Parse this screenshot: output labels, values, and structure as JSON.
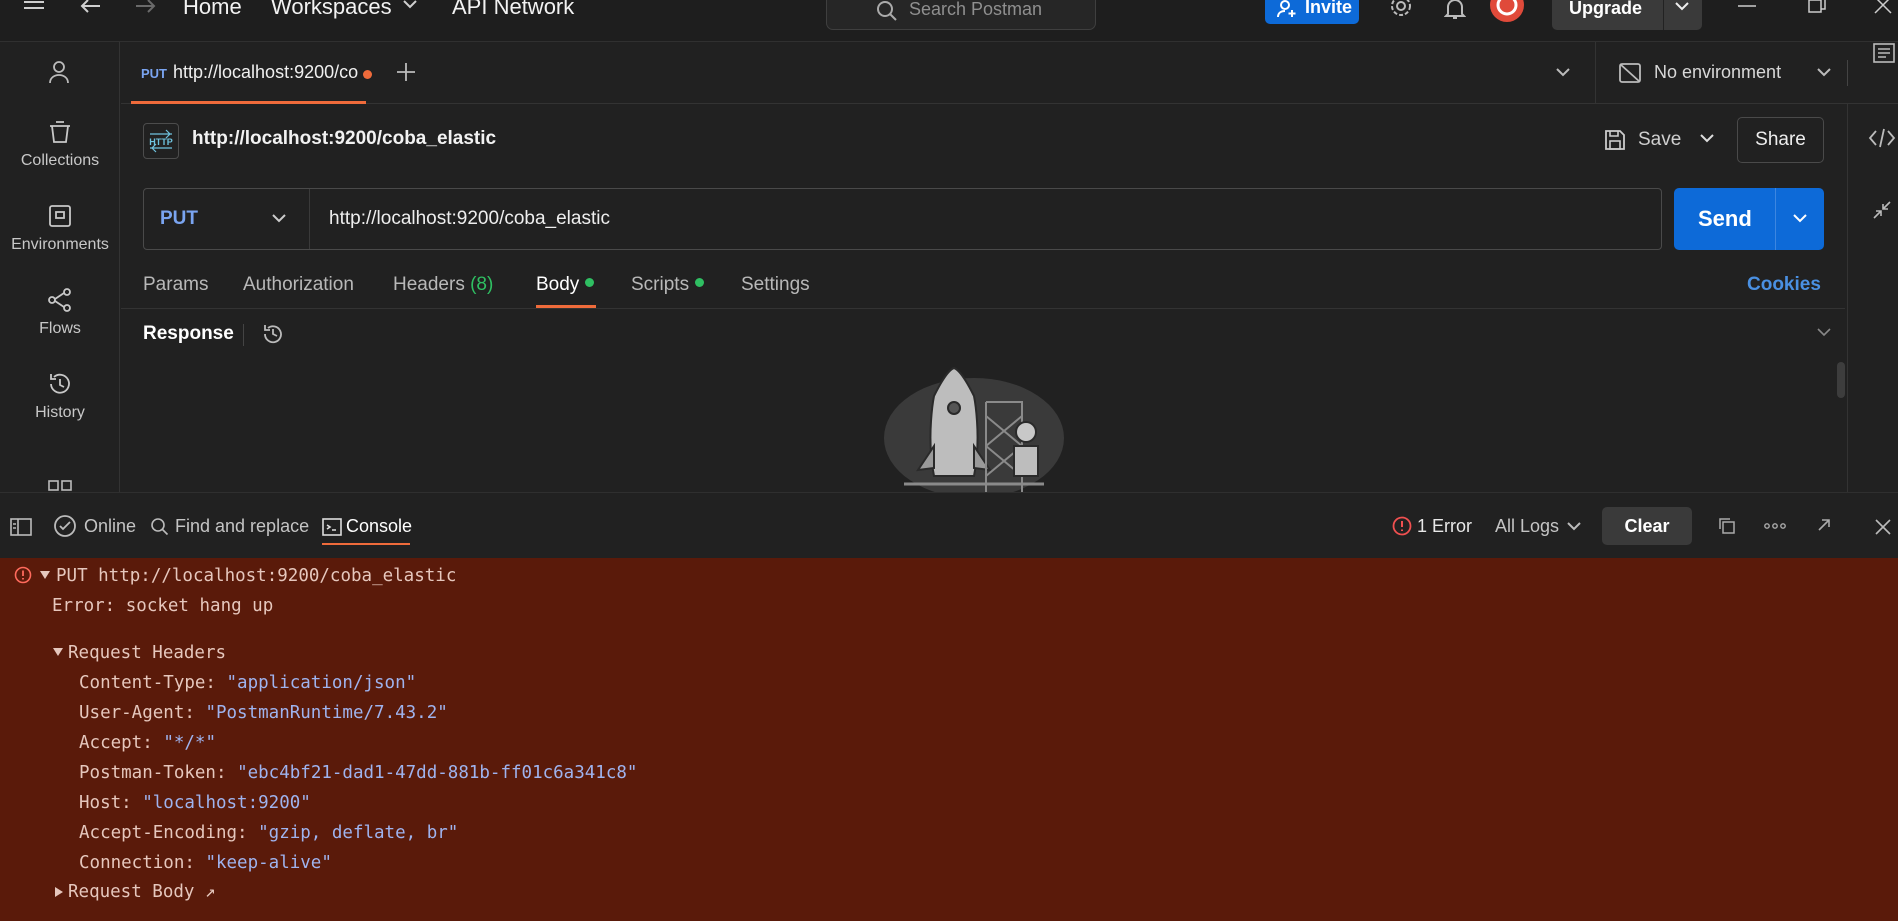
{
  "titlebar": {
    "home": "Home",
    "workspaces": "Workspaces",
    "api_network": "API Network",
    "search_placeholder": "Search Postman",
    "invite": "Invite",
    "upgrade": "Upgrade"
  },
  "sidebar": {
    "items": [
      {
        "label": "Collections",
        "icon": "collections-icon"
      },
      {
        "label": "Environments",
        "icon": "environments-icon"
      },
      {
        "label": "Flows",
        "icon": "flows-icon"
      },
      {
        "label": "History",
        "icon": "history-icon"
      }
    ]
  },
  "tab": {
    "method": "PUT",
    "url": "http://localhost:9200/coba_elastic"
  },
  "environment": "No environment",
  "request": {
    "title": "http://localhost:9200/coba_elastic",
    "save": "Save",
    "share": "Share",
    "method": "PUT",
    "url": "http://localhost:9200/coba_elastic",
    "send": "Send"
  },
  "request_tabs": {
    "params": "Params",
    "authorization": "Authorization",
    "headers": "Headers",
    "headers_count": "(8)",
    "body": "Body",
    "scripts": "Scripts",
    "settings": "Settings",
    "cookies": "Cookies"
  },
  "response": {
    "title": "Response"
  },
  "statusbar": {
    "online": "Online",
    "find_replace": "Find and replace",
    "console": "Console",
    "errors": "1 Error",
    "logs_filter": "All Logs",
    "clear": "Clear"
  },
  "console": {
    "request_line": "PUT http://localhost:9200/coba_elastic",
    "error": "Error: socket hang up",
    "headers_title": "Request Headers",
    "headers": [
      {
        "key": "Content-Type:",
        "value": "\"application/json\""
      },
      {
        "key": "User-Agent:",
        "value": "\"PostmanRuntime/7.43.2\""
      },
      {
        "key": "Accept:",
        "value": "\"*/*\""
      },
      {
        "key": "Postman-Token:",
        "value": "\"ebc4bf21-dad1-47dd-881b-ff01c6a341c8\""
      },
      {
        "key": "Host:",
        "value": "\"localhost:9200\""
      },
      {
        "key": "Accept-Encoding:",
        "value": "\"gzip, deflate, br\""
      },
      {
        "key": "Connection:",
        "value": "\"keep-alive\""
      }
    ],
    "body_title": "Request Body ↗"
  },
  "colors": {
    "accent": "#ef6b3b",
    "primary": "#0d6ad8",
    "console_error_bg": "#5a1a0a",
    "green_dot": "#2fbf62"
  }
}
